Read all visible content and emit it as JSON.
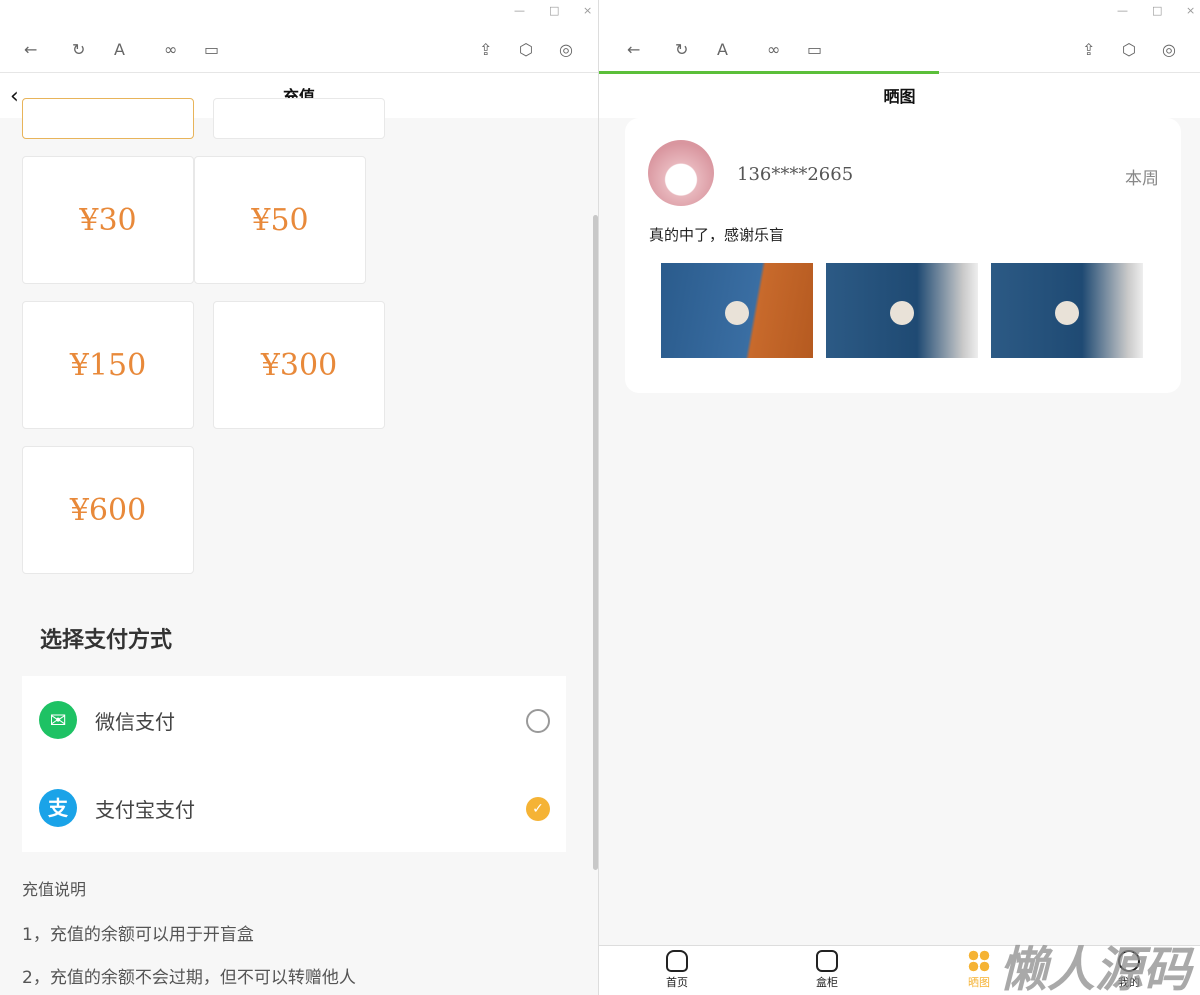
{
  "window_controls": {
    "minimize": "—",
    "maximize": "□",
    "close": "×"
  },
  "toolbar_icons": [
    "back-arrow-icon",
    "refresh-icon",
    "font-icon",
    "link-icon",
    "window-icon",
    "share-icon",
    "cube-icon",
    "target-icon"
  ],
  "left": {
    "title": "充值",
    "amounts": [
      "¥30",
      "¥50",
      "¥150",
      "¥300",
      "¥600"
    ],
    "payment_title": "选择支付方式",
    "payment_methods": [
      {
        "label": "微信支付",
        "selected": false,
        "color": "#1ec264"
      },
      {
        "label": "支付宝支付",
        "selected": true,
        "color": "#1aa3e8"
      }
    ],
    "notes_title": "充值说明",
    "notes": [
      "1，充值的余额可以用于开盲盒",
      "2，充值的余额不会过期，但不可以转赠他人"
    ]
  },
  "right": {
    "title": "晒图",
    "post": {
      "user": "136****2665",
      "time": "本周",
      "text": "真的中了，感谢乐盲"
    },
    "tabs": [
      {
        "label": "首页"
      },
      {
        "label": "盒柜"
      },
      {
        "label": "晒图",
        "active": true
      },
      {
        "label": "我的"
      }
    ],
    "watermark": "懒人源码"
  },
  "colors": {
    "accent": "#e8893a",
    "active_tab": "#f5b335",
    "progress": "#5bbf3a"
  }
}
